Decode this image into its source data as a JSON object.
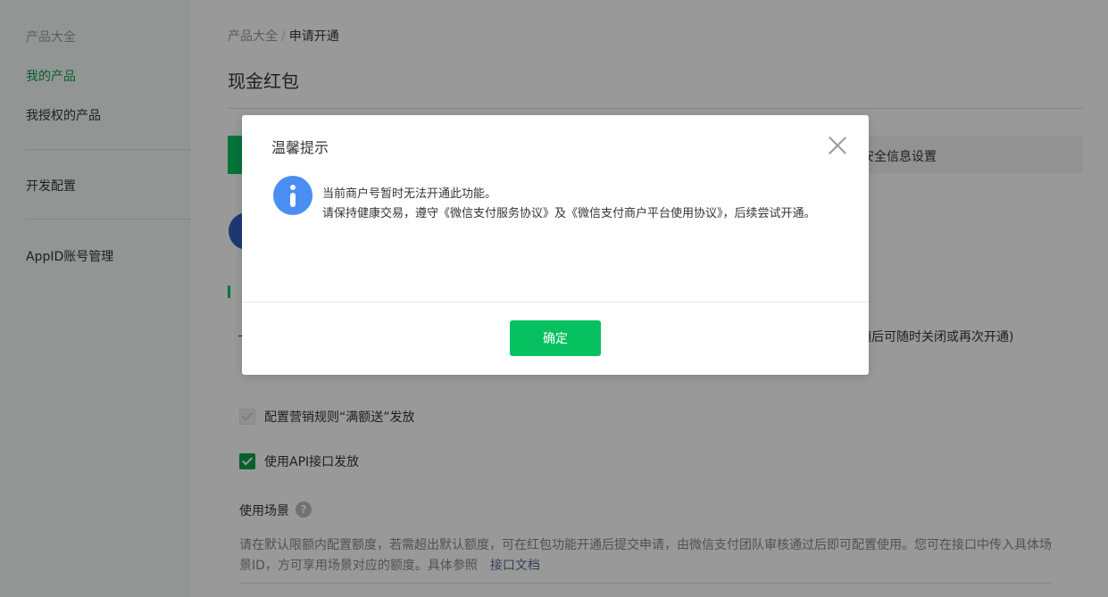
{
  "sidebar": {
    "items": [
      {
        "label": "产品大全"
      },
      {
        "label": "我的产品"
      },
      {
        "label": "我授权的产品"
      },
      {
        "label": "开发配置"
      },
      {
        "label": "AppID账号管理"
      }
    ]
  },
  "breadcrumb": {
    "items": [
      "产品大全",
      "申请开通"
    ],
    "separator": "/"
  },
  "page": {
    "title": "现金红包",
    "tab_right_label": "安全信息设置",
    "tail_text": "随后可随时关闭或再次开通)"
  },
  "options": [
    {
      "label": "配置营销规则“满额送”发放",
      "checked": true,
      "disabled": true
    },
    {
      "label": "使用API接口发放",
      "checked": true,
      "disabled": false
    }
  ],
  "scene": {
    "title": "使用场景",
    "help_icon": "?",
    "description": "请在默认限额内配置额度，若需超出默认额度，可在红包功能开通后提交申请，由微信支付团队审核通过后即可配置使用。您可在接口中传入具体场景ID，方可享用场景对应的额度。具体参照",
    "link_label": "接口文档"
  },
  "dialog": {
    "title": "温馨提示",
    "message_line1": "当前商户号暂时无法开通此功能。",
    "message_line2": "请保持健康交易，遵守《微信支付服务协议》及《微信支付商户平台使用协议》，后续尝试开通。",
    "confirm_label": "确定"
  },
  "colors": {
    "accent": "#07c160",
    "active_nav": "#07a04a",
    "info_icon": "#4a8ef3",
    "link": "#576b95"
  }
}
